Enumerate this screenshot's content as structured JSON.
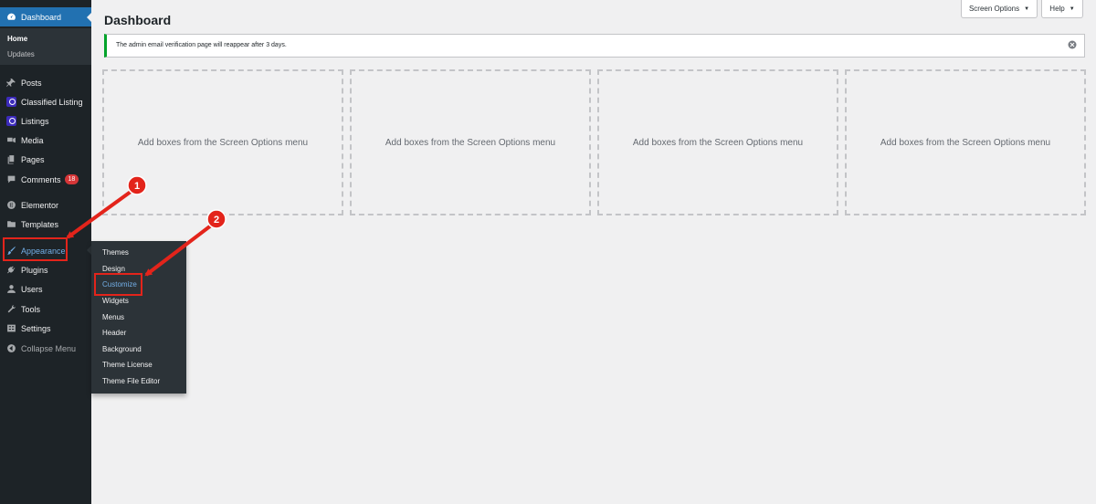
{
  "sidebar": {
    "dashboard": "Dashboard",
    "sub": [
      "Home",
      "Updates"
    ],
    "items": [
      {
        "label": "Posts",
        "icon": "pin-icon"
      },
      {
        "label": "Classified Listing",
        "icon": "classified-listing-icon"
      },
      {
        "label": "Listings",
        "icon": "listings-icon"
      },
      {
        "label": "Media",
        "icon": "media-icon"
      },
      {
        "label": "Pages",
        "icon": "pages-icon"
      },
      {
        "label": "Comments",
        "icon": "comments-icon",
        "badge": "18"
      },
      {
        "label": "Elementor",
        "icon": "elementor-icon"
      },
      {
        "label": "Templates",
        "icon": "folder-icon"
      },
      {
        "label": "Appearance",
        "icon": "paintbrush-icon"
      },
      {
        "label": "Plugins",
        "icon": "plugin-icon"
      },
      {
        "label": "Users",
        "icon": "user-icon"
      },
      {
        "label": "Tools",
        "icon": "wrench-icon"
      },
      {
        "label": "Settings",
        "icon": "settings-icon"
      },
      {
        "label": "Collapse Menu",
        "icon": "collapse-icon"
      }
    ]
  },
  "flyout": [
    "Themes",
    "Design",
    "Customize",
    "Widgets",
    "Menus",
    "Header",
    "Background",
    "Theme License",
    "Theme File Editor"
  ],
  "header": {
    "title": "Dashboard",
    "screen_options": "Screen Options",
    "help": "Help",
    "caret": "▼"
  },
  "notice": {
    "text": "The admin email verification page will reappear after 3 days."
  },
  "boxes": [
    "Add boxes from the Screen Options menu",
    "Add boxes from the Screen Options menu",
    "Add boxes from the Screen Options menu",
    "Add boxes from the Screen Options menu"
  ],
  "annotations": {
    "step1": "1",
    "step2": "2",
    "color": "#e3241b"
  },
  "colors": {
    "sidebar_bg": "#1d2327",
    "active": "#2271b1",
    "accent_link": "#72aee6",
    "notice_success": "#00a32a",
    "badge": "#d63638"
  }
}
